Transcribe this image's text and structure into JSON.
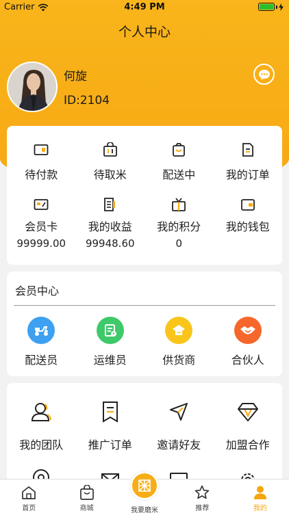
{
  "status": {
    "carrier": "Carrier",
    "time": "4:49 PM"
  },
  "nav": {
    "title": "个人中心"
  },
  "user": {
    "name": "何旋",
    "id": "ID:2104"
  },
  "orders": [
    {
      "label": "待付款",
      "icon": "wallet-icon"
    },
    {
      "label": "待取米",
      "icon": "bag-icon"
    },
    {
      "label": "配送中",
      "icon": "box-icon"
    },
    {
      "label": "我的订单",
      "icon": "document-icon"
    }
  ],
  "assets": [
    {
      "label": "会员卡",
      "value": "99999.00",
      "icon": "card-icon"
    },
    {
      "label": "我的收益",
      "value": "99948.60",
      "icon": "receipt-icon"
    },
    {
      "label": "我的积分",
      "value": "0",
      "icon": "gift-icon"
    },
    {
      "label": "我的钱包",
      "value": "",
      "icon": "purse-icon"
    }
  ],
  "member_center": {
    "title": "会员中心",
    "roles": [
      {
        "label": "配送员",
        "icon": "scooter-icon",
        "color": "#3da0f0"
      },
      {
        "label": "运维员",
        "icon": "checklist-icon",
        "color": "#3ec96a"
      },
      {
        "label": "供货商",
        "icon": "supplier-icon",
        "color": "#f9c51b"
      },
      {
        "label": "合伙人",
        "icon": "handshake-icon",
        "color": "#f5672b"
      }
    ]
  },
  "tools": [
    {
      "label": "我的团队",
      "icon": "team-icon"
    },
    {
      "label": "推广订单",
      "icon": "bookmark-icon"
    },
    {
      "label": "邀请好友",
      "icon": "send-icon"
    },
    {
      "label": "加盟合作",
      "icon": "diamond-icon"
    }
  ],
  "tabs": [
    {
      "label": "首页",
      "icon": "home-icon"
    },
    {
      "label": "商城",
      "icon": "shop-bag-icon"
    },
    {
      "label": "我要磨米",
      "icon": "mill-icon"
    },
    {
      "label": "推荐",
      "icon": "star-icon"
    },
    {
      "label": "我的",
      "icon": "person-icon"
    }
  ],
  "colors": {
    "primary": "#f7ae16",
    "active_tab": "#f5a70e"
  }
}
